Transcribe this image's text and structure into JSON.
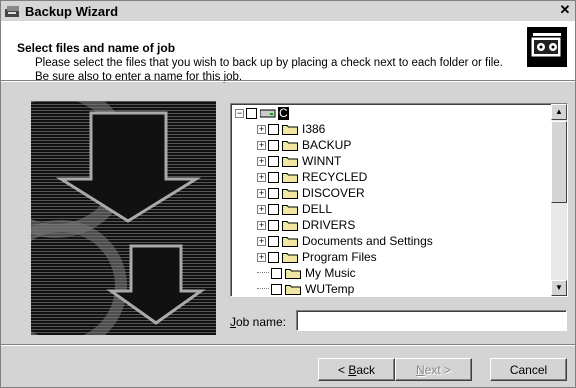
{
  "window": {
    "title": "Backup Wizard",
    "close_glyph": "✕"
  },
  "header": {
    "heading": "Select files and name of job",
    "description": "Please select the files that you wish to back up by placing a check next to each folder or file. Be sure also to enter a name for this job."
  },
  "tree": {
    "root": "C",
    "items": [
      {
        "label": "I386",
        "expandable": true
      },
      {
        "label": "BACKUP",
        "expandable": true
      },
      {
        "label": "WINNT",
        "expandable": true
      },
      {
        "label": "RECYCLED",
        "expandable": true
      },
      {
        "label": "DISCOVER",
        "expandable": true
      },
      {
        "label": "DELL",
        "expandable": true
      },
      {
        "label": "DRIVERS",
        "expandable": true
      },
      {
        "label": "Documents and Settings",
        "expandable": true
      },
      {
        "label": "Program Files",
        "expandable": true
      },
      {
        "label": "My Music",
        "expandable": false
      },
      {
        "label": "WUTemp",
        "expandable": false
      }
    ]
  },
  "job": {
    "label_prefix": "J",
    "label_rest": "ob name:",
    "value": ""
  },
  "buttons": {
    "back_prefix": "< ",
    "back_u": "B",
    "back_rest": "ack",
    "next_u": "N",
    "next_rest": "ext >",
    "cancel": "Cancel"
  },
  "colors": {
    "title_bg": "#d6d6d6",
    "dialog_bg": "#d4d4d4",
    "folder_yellow": "#f0e8a0"
  }
}
